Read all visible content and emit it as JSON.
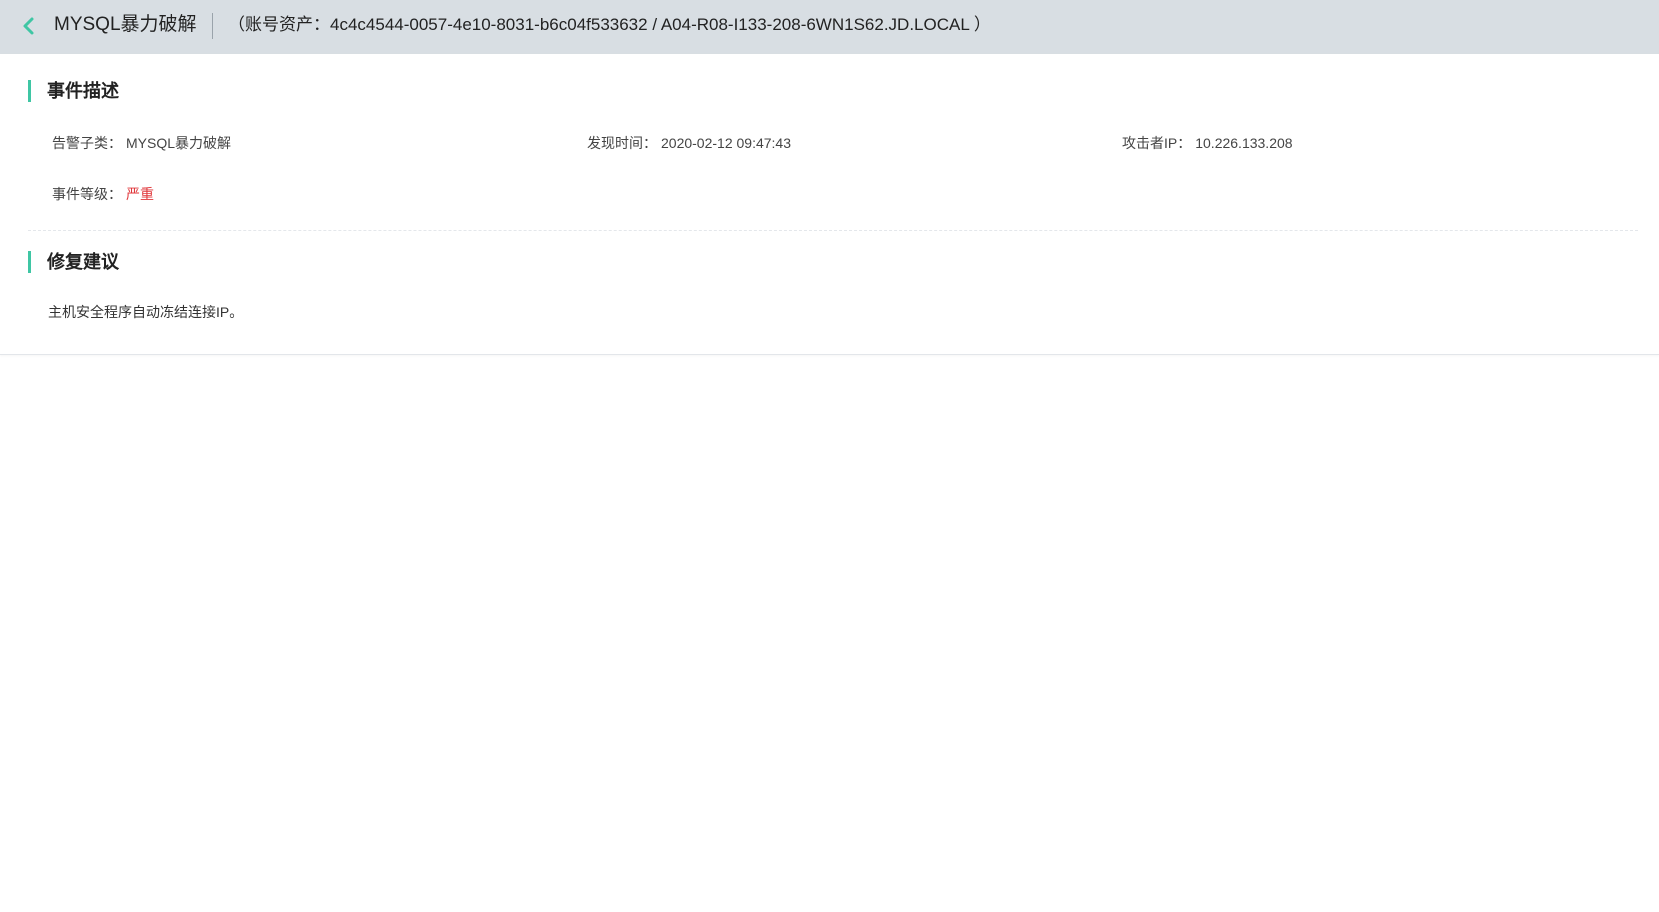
{
  "header": {
    "back_icon": "chevron-left-icon",
    "title": "MYSQL暴力破解",
    "asset_text": "（账号资产：4c4c4544-0057-4e10-8031-b6c04f533632 / A04-R08-I133-208-6WN1S62.JD.LOCAL ）",
    "accent_color": "#3fc6a4"
  },
  "event_description": {
    "title": "事件描述",
    "fields": [
      {
        "label": "告警子类：",
        "value": "MYSQL暴力破解"
      },
      {
        "label": "发现时间：",
        "value": "2020-02-12 09:47:43"
      },
      {
        "label": "攻击者IP：",
        "value": "10.226.133.208"
      },
      {
        "label": "事件等级：",
        "value": "严重",
        "value_color": "#e0363a"
      }
    ]
  },
  "repair_suggestion": {
    "title": "修复建议",
    "text": "主机安全程序自动冻结连接IP。"
  }
}
